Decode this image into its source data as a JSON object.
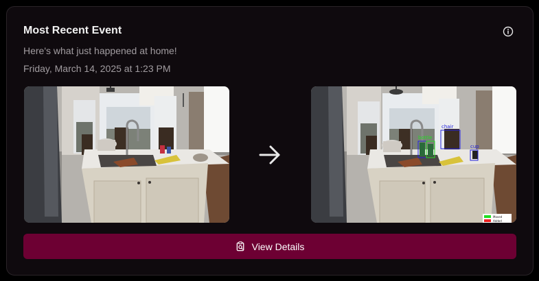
{
  "card": {
    "title": "Most Recent Event",
    "subtitle": "Here's what just happened at home!",
    "timestamp": "Friday, March 14, 2025 at 1:23 PM",
    "info_icon": "info-circle-icon",
    "arrow_icon": "arrow-right-icon",
    "button_icon": "clipboard-search-icon",
    "button_label": "View Details"
  },
  "detections": {
    "labels": [
      "chair",
      "cup",
      "bottle"
    ],
    "legend": [
      "Moved",
      "Added"
    ]
  },
  "colors": {
    "background": "#000000",
    "card": "#0f0a0e",
    "accent": "#6d0033",
    "text_primary": "#f2f2f2",
    "text_secondary": "#a19ca0",
    "box_blue": "#2222dd",
    "box_green": "#22dd22",
    "legend_red": "#ee2222"
  }
}
